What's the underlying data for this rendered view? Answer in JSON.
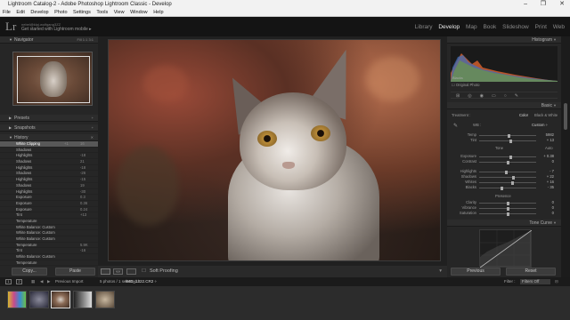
{
  "window": {
    "title": "Lightroom Catalog-2 - Adobe Photoshop Lightroom Classic - Develop",
    "minimize": "–",
    "maximize": "❐",
    "close": "✕"
  },
  "menu": [
    "File",
    "Edit",
    "Develop",
    "Photo",
    "Settings",
    "Tools",
    "View",
    "Window",
    "Help"
  ],
  "identity": {
    "logo": "Lr",
    "user": "nebel@klpj.wolfgang3ZZ",
    "mobile": "Get started with Lightroom mobile ▸"
  },
  "modules": {
    "items": [
      "Library",
      "Develop",
      "Map",
      "Book",
      "Slideshow",
      "Print",
      "Web"
    ],
    "active": "Develop"
  },
  "left": {
    "navigator": {
      "title": "Navigator",
      "zoom": "Fill  1:1  3:1"
    },
    "presets": "Presets",
    "snapshots": "Snapshots",
    "history": {
      "title": "History",
      "items": [
        {
          "label": "White Clipping",
          "a": "+1",
          "b": "16"
        },
        {
          "label": "Shadows",
          "a": "",
          "b": ""
        },
        {
          "label": "Highlights",
          "a": "",
          "b": "-18"
        },
        {
          "label": "Shadows",
          "a": "",
          "b": "21"
        },
        {
          "label": "Highlights",
          "a": "",
          "b": "-18"
        },
        {
          "label": "Shadows",
          "a": "",
          "b": "-26"
        },
        {
          "label": "Highlights",
          "a": "",
          "b": "-15"
        },
        {
          "label": "Shadows",
          "a": "",
          "b": "19"
        },
        {
          "label": "Highlights",
          "a": "",
          "b": "-30"
        },
        {
          "label": "Exposure",
          "a": "",
          "b": "0.3"
        },
        {
          "label": "Exposure",
          "a": "",
          "b": "0.36"
        },
        {
          "label": "Exposure",
          "a": "",
          "b": "0.24"
        },
        {
          "label": "Tint",
          "a": "",
          "b": "+13"
        },
        {
          "label": "Temperature",
          "a": "",
          "b": ""
        },
        {
          "label": "White Balance: Custom",
          "a": "",
          "b": ""
        },
        {
          "label": "White Balance: Custom",
          "a": "",
          "b": ""
        },
        {
          "label": "White Balance: Custom",
          "a": "",
          "b": ""
        },
        {
          "label": "Temperature",
          "a": "",
          "b": "5.9K"
        },
        {
          "label": "Tint",
          "a": "",
          "b": "-16"
        },
        {
          "label": "White Balance: Custom",
          "a": "",
          "b": ""
        },
        {
          "label": "Temperature",
          "a": "",
          "b": ""
        }
      ]
    },
    "buttons": {
      "copy": "Copy...",
      "paste": "Paste"
    }
  },
  "toolbar": {
    "soft_proofing": "Soft Proofing"
  },
  "right": {
    "histogram": {
      "title": "Histogram",
      "label": "Blacks",
      "original": "Original Photo"
    },
    "basic": {
      "title": "Basic",
      "treatment": "Treatment :",
      "color": "Color",
      "bw": "Black & White",
      "wb": "WB :",
      "wb_value": "Custom ÷",
      "tone": "Tone",
      "auto": "Auto",
      "presence": "Presence",
      "sliders": [
        {
          "label": "Temp",
          "value": "5982",
          "pos": 0.52
        },
        {
          "label": "Tint",
          "value": "+ 13",
          "pos": 0.56
        },
        {
          "label": "Exposure",
          "value": "+ 0.38",
          "pos": 0.55
        },
        {
          "label": "Contrast",
          "value": "0",
          "pos": 0.5
        },
        {
          "label": "Highlights",
          "value": "- 7",
          "pos": 0.47
        },
        {
          "label": "Shadows",
          "value": "+ 22",
          "pos": 0.6
        },
        {
          "label": "Whites",
          "value": "+ 16",
          "pos": 0.58
        },
        {
          "label": "Blacks",
          "value": "- 35",
          "pos": 0.4
        },
        {
          "label": "Clarity",
          "value": "0",
          "pos": 0.5
        },
        {
          "label": "Vibrance",
          "value": "0",
          "pos": 0.5
        },
        {
          "label": "Saturation",
          "value": "0",
          "pos": 0.5
        }
      ]
    },
    "tone_curve": {
      "title": "Tone Curve"
    },
    "buttons": {
      "previous": "Previous",
      "reset": "Reset"
    }
  },
  "filmstrip": {
    "view1": "1",
    "view2": "2",
    "prev_import": "Previous Import",
    "info": "5 photos / 1 selected /",
    "filename": "IMG_1322.CR2 ÷",
    "filter": "Filter :",
    "filter_value": "Filters Off"
  },
  "colors": {
    "accent": "#e0e0e0",
    "bg": "#262626",
    "titlebar": "#f2f2f2"
  }
}
